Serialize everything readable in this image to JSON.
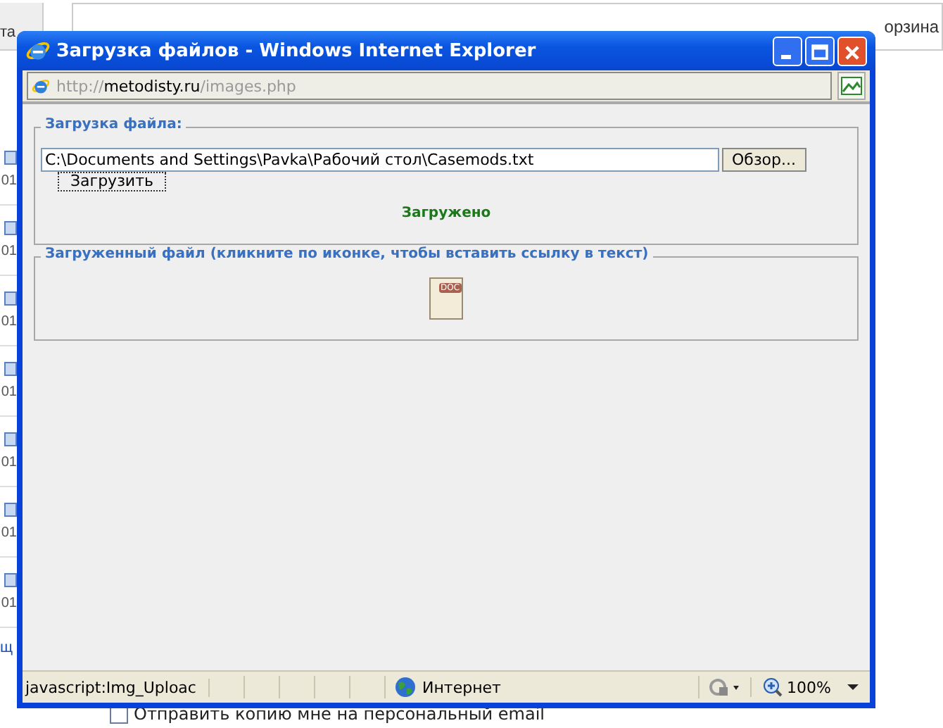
{
  "background_page": {
    "tab_fragment": "та",
    "cart_fragment": "орзина",
    "list_dates": [
      "01",
      "01",
      "01",
      "01",
      "01",
      "01",
      "01"
    ],
    "side_fragment": "щ",
    "copy_checkbox": {
      "label": "Отправить копию мне на персональный email",
      "checked": false
    }
  },
  "window": {
    "title": "Загрузка файлов - Windows Internet Explorer",
    "address": {
      "prefix": "http://",
      "domain": "metodisty.ru",
      "path": "/images.php"
    }
  },
  "upload_section": {
    "legend": "Загрузка файла:",
    "file_path": "C:\\Documents and Settings\\Pavka\\Рабочий стол\\Casemods.txt",
    "browse_button": "Обзор...",
    "upload_button": "Загрузить",
    "status": "Загружено"
  },
  "uploaded_section": {
    "legend": "Загруженный файл (кликните по иконке, чтобы вставить ссылку в текст)",
    "file_badge": "DOC"
  },
  "status_bar": {
    "url": "javascript:Img_Uploac",
    "zone": "Интернет",
    "zoom": "100%"
  }
}
